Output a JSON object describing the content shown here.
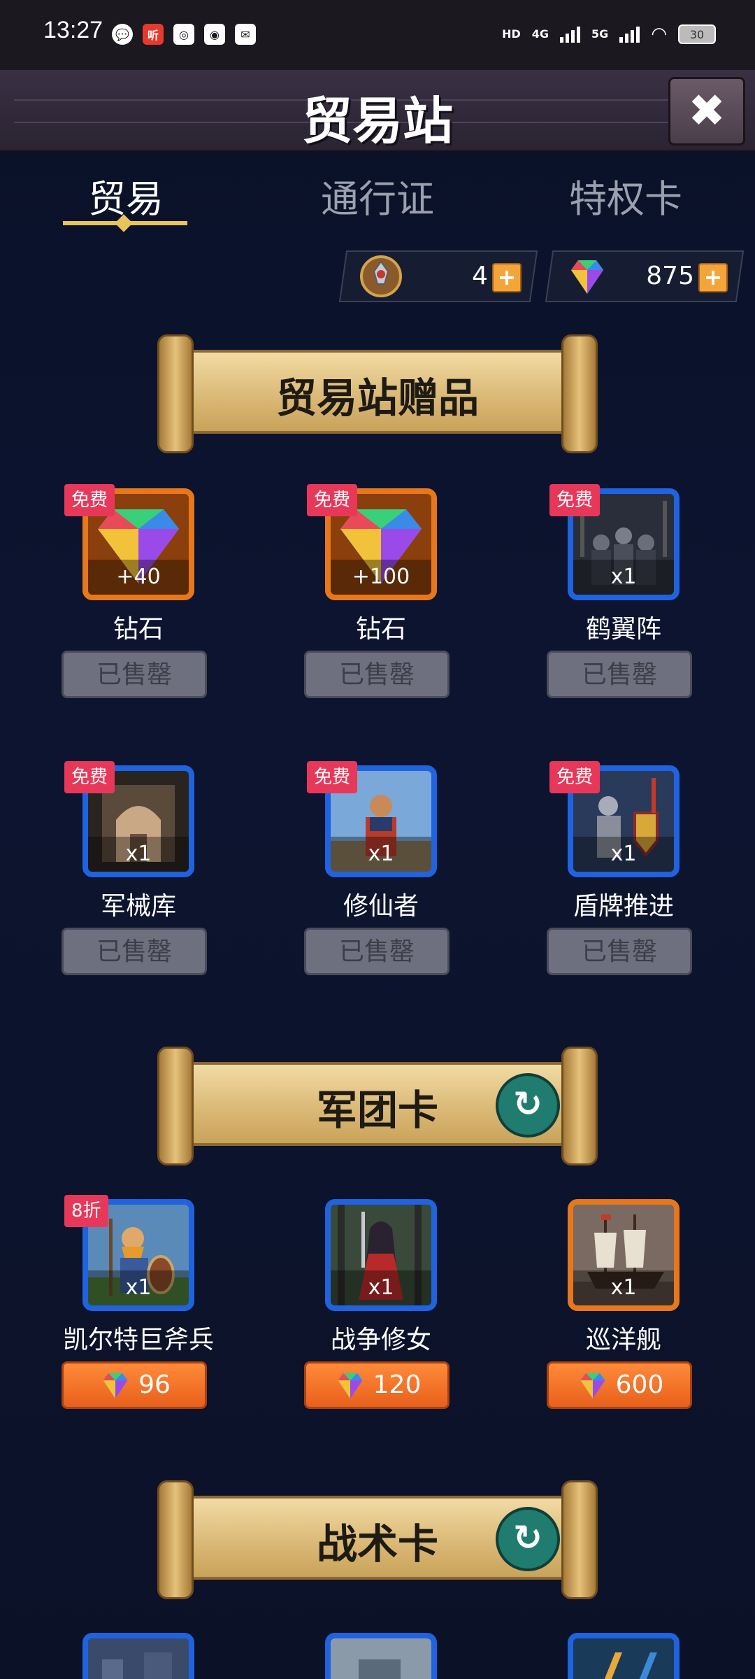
{
  "status_bar": {
    "time": "13:27",
    "icons": [
      "chat-bubble-icon",
      "ting-app-icon",
      "app-icon",
      "camera-icon",
      "message-icon"
    ],
    "ting_label": "听",
    "hd_label": "HD",
    "net_4g": "4G",
    "net_5g": "5G",
    "battery": "30"
  },
  "header": {
    "title": "贸易站",
    "close_label": "✖"
  },
  "tabs": [
    {
      "label": "贸易",
      "active": true
    },
    {
      "label": "通行证",
      "active": false
    },
    {
      "label": "特权卡",
      "active": false
    }
  ],
  "currency": [
    {
      "icon": "medal-emblem-icon",
      "value": "4",
      "plus": "+"
    },
    {
      "icon": "diamond-icon",
      "value": "875",
      "plus": "+"
    }
  ],
  "sections": {
    "gifts": {
      "title": "贸易站赠品",
      "items": [
        {
          "badge": "免费",
          "name": "钻石",
          "qty": "+40",
          "icon": "diamond-icon",
          "frame": "orange",
          "button": "已售罄"
        },
        {
          "badge": "免费",
          "name": "钻石",
          "qty": "+100",
          "icon": "diamond-icon",
          "frame": "orange",
          "button": "已售罄"
        },
        {
          "badge": "免费",
          "name": "鹤翼阵",
          "qty": "x1",
          "icon": "crane-wing-formation-card",
          "frame": "blue",
          "button": "已售罄"
        },
        {
          "badge": "免费",
          "name": "军械库",
          "qty": "x1",
          "icon": "armory-card",
          "frame": "blue",
          "button": "已售罄"
        },
        {
          "badge": "免费",
          "name": "修仙者",
          "qty": "x1",
          "icon": "cultivator-card",
          "frame": "blue",
          "button": "已售罄"
        },
        {
          "badge": "免费",
          "name": "盾牌推进",
          "qty": "x1",
          "icon": "shield-push-card",
          "frame": "blue",
          "button": "已售罄"
        }
      ]
    },
    "legion": {
      "title": "军团卡",
      "refresh_label": "↻",
      "items": [
        {
          "badge": "8折",
          "name": "凯尔特巨斧兵",
          "qty": "x1",
          "icon": "celtic-axeman-card",
          "frame": "blue",
          "price": "96"
        },
        {
          "badge": "",
          "name": "战争修女",
          "qty": "x1",
          "icon": "war-nun-card",
          "frame": "blue",
          "price": "120"
        },
        {
          "badge": "",
          "name": "巡洋舰",
          "qty": "x1",
          "icon": "cruiser-ship-card",
          "frame": "orange",
          "price": "600"
        }
      ]
    },
    "tactics": {
      "title": "战术卡",
      "refresh_label": "↻",
      "items": [
        {
          "icon": "tactic-card-1",
          "frame": "blue"
        },
        {
          "icon": "tactic-card-2",
          "frame": "blue"
        },
        {
          "icon": "tactic-card-3",
          "frame": "blue"
        }
      ]
    }
  },
  "colors": {
    "background": "#0b1228",
    "free_badge": "#e8385a",
    "orange_frame": "#e8771c",
    "blue_frame": "#1f63e0",
    "buy_button": "#f07a2c",
    "sold_button": "#6e7080",
    "refresh_button": "#1f7c6e"
  }
}
